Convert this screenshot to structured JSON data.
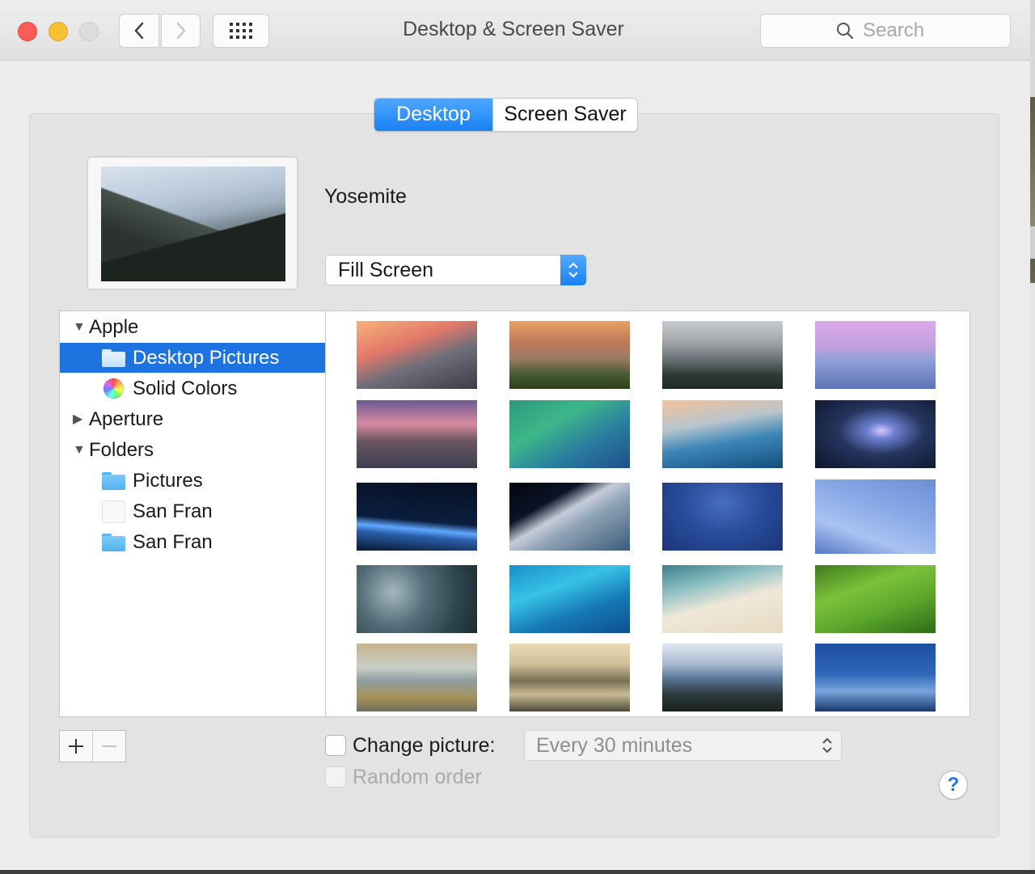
{
  "window": {
    "title": "Desktop & Screen Saver",
    "search_placeholder": "Search"
  },
  "tabs": [
    {
      "label": "Desktop",
      "selected": true
    },
    {
      "label": "Screen Saver",
      "selected": false
    }
  ],
  "current": {
    "wallpaper_name": "Yosemite",
    "fit_mode": "Fill Screen"
  },
  "sources": [
    {
      "label": "Apple",
      "type": "group",
      "expanded": true
    },
    {
      "label": "Desktop Pictures",
      "type": "folder",
      "selected": true
    },
    {
      "label": "Solid Colors",
      "type": "colors"
    },
    {
      "label": "Aperture",
      "type": "group",
      "expanded": false
    },
    {
      "label": "Folders",
      "type": "group",
      "expanded": true
    },
    {
      "label": "Pictures",
      "type": "folder"
    },
    {
      "label": "San Fran",
      "type": "blank"
    },
    {
      "label": "San Fran",
      "type": "folder"
    }
  ],
  "thumbnails_count": 20,
  "options": {
    "change_picture_label": "Change picture:",
    "change_picture_checked": false,
    "interval": "Every 30 minutes",
    "random_order_label": "Random order",
    "random_order_checked": false
  },
  "icons": {
    "back": "chevron-left-icon",
    "forward": "chevron-right-icon",
    "grid": "grid-icon",
    "search": "magnifier-icon",
    "help": "?"
  }
}
